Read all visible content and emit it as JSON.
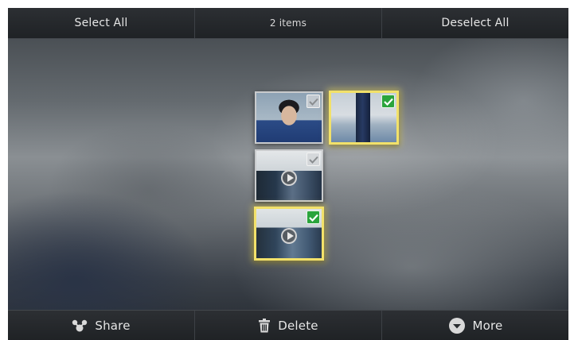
{
  "action_bar": {
    "select_all": "Select All",
    "item_count": "2 items",
    "deselect_all": "Deselect All"
  },
  "bottom_bar": {
    "share": "Share",
    "delete": "Delete",
    "more": "More"
  },
  "thumbnails": [
    {
      "kind": "photo",
      "subject": "portrait",
      "selected": false
    },
    {
      "kind": "photo",
      "subject": "bottle",
      "selected": true
    },
    {
      "kind": "video",
      "subject": "office",
      "selected": false
    },
    {
      "kind": "video",
      "subject": "office",
      "selected": true
    }
  ],
  "colors": {
    "selection_border": "#f2e16a",
    "checkmark_on": "#2aa43c",
    "bar_background": "#25282b"
  },
  "icons": [
    "share-icon",
    "trash-icon",
    "more-chevron-icon",
    "checkmark-icon",
    "play-icon"
  ]
}
